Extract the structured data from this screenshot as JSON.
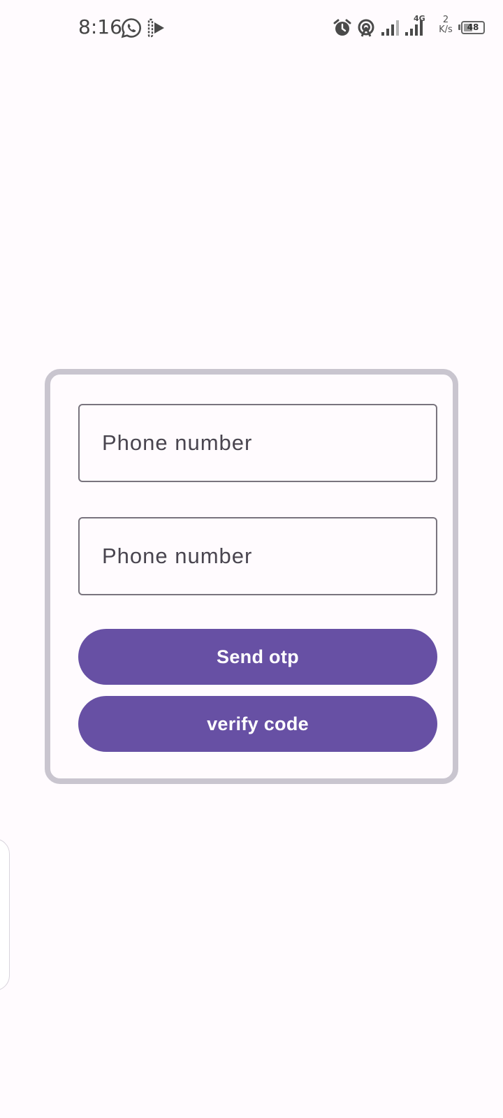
{
  "status_bar": {
    "time": "8:16",
    "net_speed_value": "2",
    "net_speed_unit": "K/s",
    "network_type": "4G",
    "battery_level": "48",
    "battery_fraction": 0.48,
    "icons": [
      "whatsapp-icon",
      "media-icon",
      "alarm-icon",
      "hotspot-icon",
      "signal-icon",
      "signal-4g-icon",
      "battery-icon"
    ]
  },
  "form": {
    "field_1": {
      "placeholder": "Phone number",
      "value": ""
    },
    "field_2": {
      "placeholder": "Phone number",
      "value": ""
    },
    "send_label": "Send otp",
    "verify_label": "verify code"
  },
  "colors": {
    "primary": "#6750a4",
    "background": "#fffbfe",
    "card_border": "#c9c5cf",
    "field_border": "#79747e"
  }
}
